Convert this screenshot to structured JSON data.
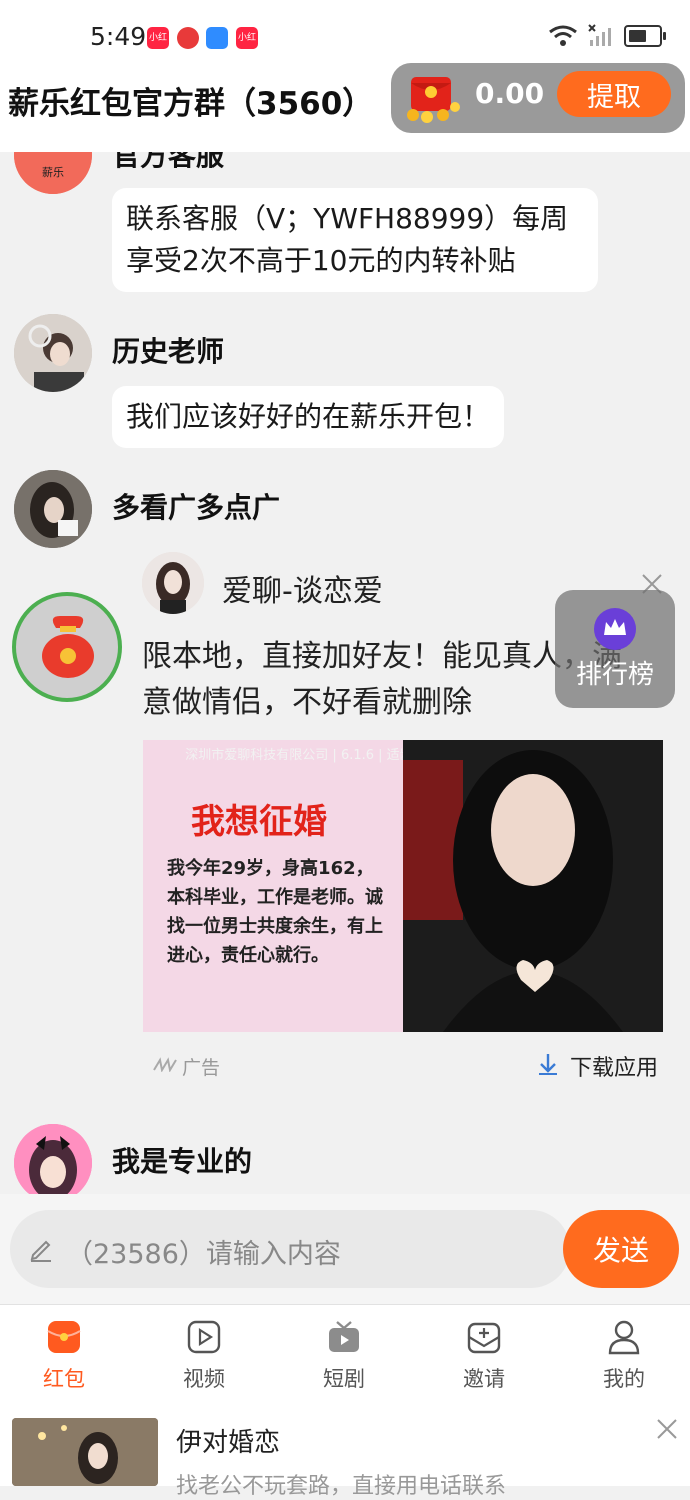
{
  "status_bar": {
    "time": "5:49",
    "notification_labels": [
      "小红书",
      "",
      "",
      "小红书"
    ]
  },
  "header": {
    "title": "薪乐红包官方群（3560）",
    "balance": "0.00",
    "withdraw_label": "提取"
  },
  "messages": [
    {
      "sender": "官方客服",
      "text": "联系客服（V；YWFH88999）每周享受2次不高于10元的内转补贴"
    },
    {
      "sender": "历史老师",
      "text": "我们应该好好的在薪乐开包！"
    },
    {
      "sender": "多看广多点广"
    },
    {
      "sender": "我是专业的"
    }
  ],
  "official_logo_text": "薪乐",
  "chat_ad": {
    "title": "爱聊-谈恋爱",
    "text": "限本地，直接加好友！能见真人，满意做情侣，不好看就删除",
    "image_caption": "深圳市爱聊科技有限公司 | 6.1.6 | 适龄18+ | 权限 | 隐私 | 功能 | 备案信息",
    "image_headline": "我想征婚",
    "image_body": "我今年29岁，身高162，本科毕业，工作是老师。诚找一位男士共度余生，有上进心，责任心就行。",
    "ad_tag": "广告",
    "download_label": "下载应用"
  },
  "ranking_label": "排行榜",
  "input": {
    "placeholder": "（23586）请输入内容",
    "send_label": "发送"
  },
  "tabs": [
    {
      "label": "红包",
      "icon": "red-packet-icon",
      "active": true
    },
    {
      "label": "视频",
      "icon": "video-icon"
    },
    {
      "label": "短剧",
      "icon": "tv-icon"
    },
    {
      "label": "邀请",
      "icon": "invite-icon"
    },
    {
      "label": "我的",
      "icon": "user-icon"
    }
  ],
  "bottom_ad": {
    "title": "伊对婚恋",
    "subtitle": "找老公不玩套路，直接用电话联系"
  },
  "colors": {
    "accent": "#ff6b1e",
    "active_tab": "#ff5a1f",
    "chat_bg": "#f1f1f1"
  }
}
